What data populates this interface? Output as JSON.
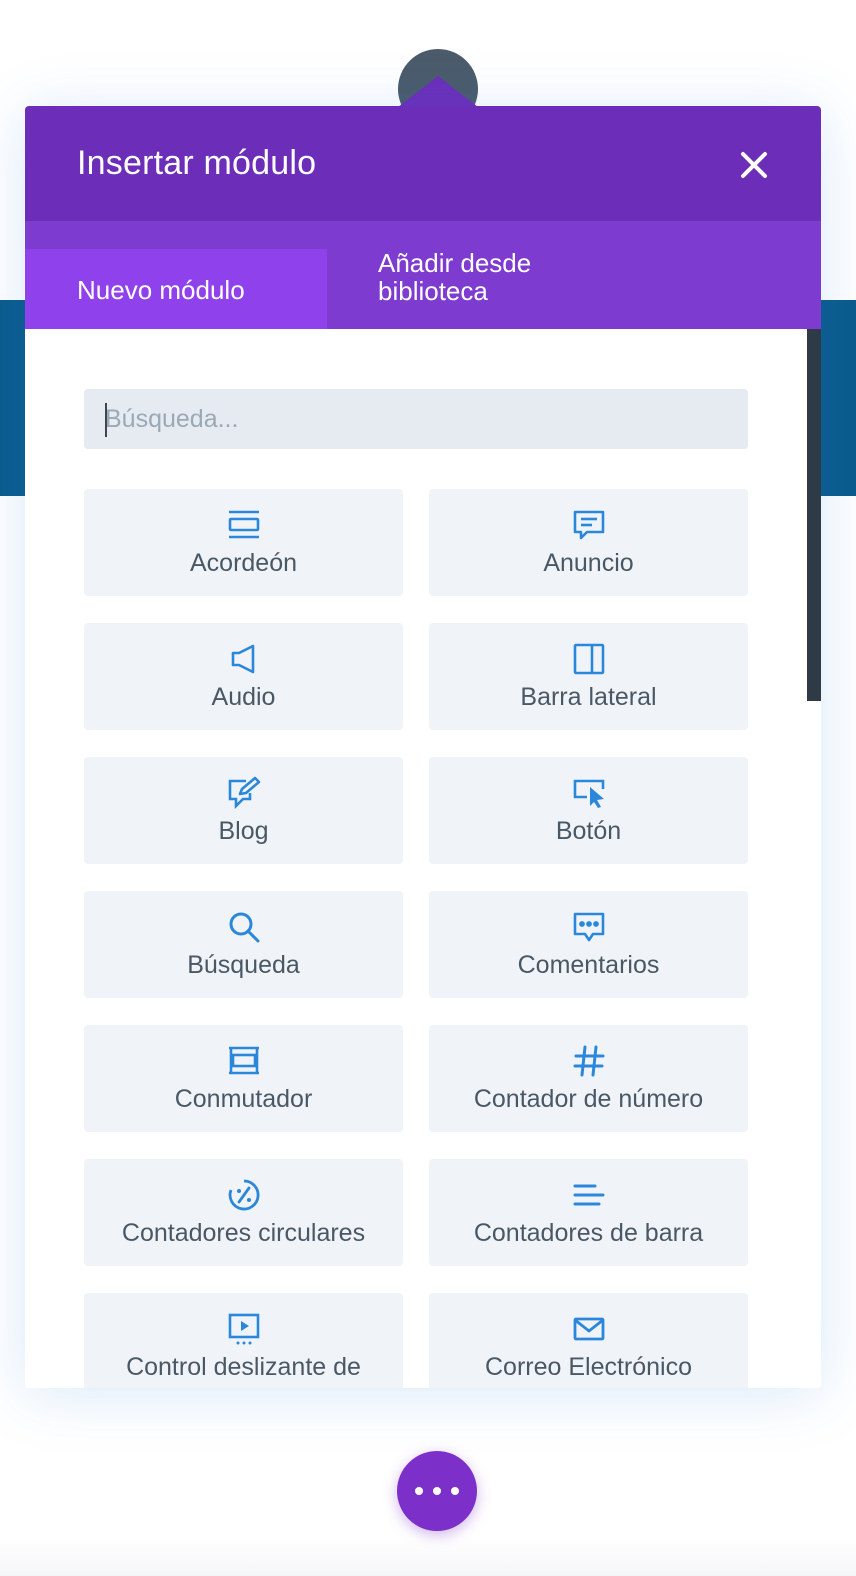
{
  "modal": {
    "title": "Insertar módulo",
    "close_icon": "close-icon"
  },
  "tabs": [
    {
      "label": "Nuevo módulo",
      "active": true
    },
    {
      "label": "Añadir desde biblioteca",
      "active": false
    }
  ],
  "search": {
    "placeholder": "Búsqueda...",
    "value": ""
  },
  "modules": [
    {
      "label": "Acordeón",
      "icon": "accordion-icon"
    },
    {
      "label": "Anuncio",
      "icon": "message-icon"
    },
    {
      "label": "Audio",
      "icon": "speaker-icon"
    },
    {
      "label": "Barra lateral",
      "icon": "sidebar-icon"
    },
    {
      "label": "Blog",
      "icon": "edit-icon"
    },
    {
      "label": "Botón",
      "icon": "cursor-click-icon"
    },
    {
      "label": "Búsqueda",
      "icon": "search-icon"
    },
    {
      "label": "Comentarios",
      "icon": "comment-icon"
    },
    {
      "label": "Conmutador",
      "icon": "toggle-icon"
    },
    {
      "label": "Contador de número",
      "icon": "hash-icon"
    },
    {
      "label": "Contadores circulares",
      "icon": "circle-percent-icon"
    },
    {
      "label": "Contadores de barra",
      "icon": "bars-icon"
    },
    {
      "label": "Control deslizante de",
      "icon": "slider-play-icon"
    },
    {
      "label": "Correo Electrónico",
      "icon": "email-icon"
    }
  ],
  "colors": {
    "header": "#6c2eb9",
    "tabs": "#7d3bcf",
    "active_tab": "#8f42ec",
    "icon": "#2b87da",
    "item_bg": "#f0f4f8"
  }
}
